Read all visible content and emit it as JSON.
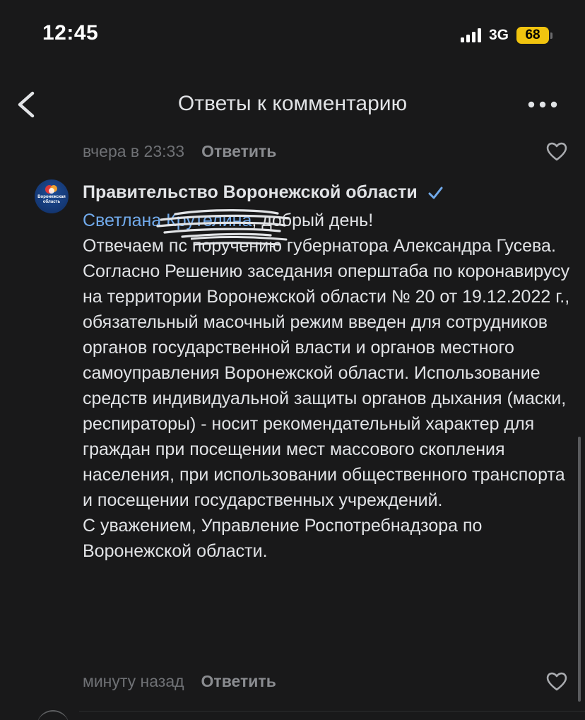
{
  "status_bar": {
    "time": "12:45",
    "network": "3G",
    "battery": "68"
  },
  "header": {
    "title": "Ответы к комментарию",
    "back_icon": "chevron-left-icon",
    "more_icon": "more-horizontal-icon"
  },
  "previous_comment": {
    "time": "вчера в 23:33",
    "reply_label": "Ответить"
  },
  "comment": {
    "author": "Правительство Воронежской области",
    "avatar_text": "Воронежская область",
    "verified": true,
    "mention_visible": "Светлана К",
    "mention_hidden_part": "рутелина",
    "greeting": ", добрый день!",
    "line2a": "Отвечаем п",
    "line2b": "с поручению губернатора Александра Гусева.",
    "body": "Согласно Решению заседания оперштаба по коронавирусу на территории Воронежской области № 20 от 19.12.2022 г., обязательный масочный режим введен для сотрудников органов государственной власти и органов местного самоуправления Воронежской области. Использование средств индивидуальной защиты органов дыхания (маски, респираторы) - носит рекомендательный характер для граждан при посещении мест массового скопления населения, при использовании общественного транспорта и посещении государственных учреждений.",
    "signature": "С уважением, Управление Роспотребнадзора по Воронежской области.",
    "time": "минуту назад",
    "reply_label": "Ответить"
  },
  "colors": {
    "background": "#19191a",
    "text": "#e1e3e6",
    "link": "#71aaeb",
    "muted": "#6f7175",
    "battery": "#f1c40f"
  }
}
